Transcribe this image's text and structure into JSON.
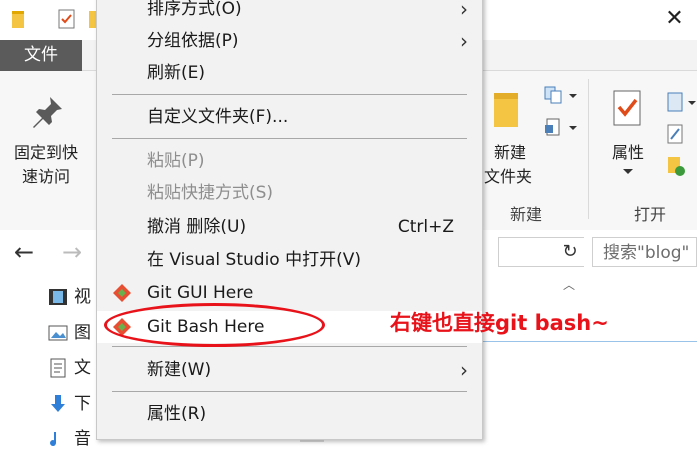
{
  "explorer": {
    "file_tab": "文件",
    "pin_label_line1": "固定到快",
    "pin_label_line2": "速访问",
    "new_folder_line1": "新建",
    "new_folder_line2": "文件夹",
    "new_group": "新建",
    "properties_label": "属性",
    "open_group": "打开",
    "search_placeholder": "搜索\"blog\"",
    "tree_items": [
      "视",
      "图",
      "文",
      "下",
      "音"
    ]
  },
  "context_menu": {
    "items": [
      {
        "label": "排序方式(O)",
        "shortcut": "",
        "submenu": true
      },
      {
        "label": "分组依据(P)",
        "shortcut": "",
        "submenu": true
      },
      {
        "label": "刷新(E)",
        "shortcut": "",
        "submenu": false
      },
      {
        "label": "自定义文件夹(F)...",
        "shortcut": "",
        "submenu": false
      },
      {
        "label": "粘贴(P)",
        "shortcut": "",
        "submenu": false,
        "disabled": true
      },
      {
        "label": "粘贴快捷方式(S)",
        "shortcut": "",
        "submenu": false,
        "disabled": true
      },
      {
        "label": "撤消 删除(U)",
        "shortcut": "Ctrl+Z",
        "submenu": false
      },
      {
        "label": "在 Visual Studio 中打开(V)",
        "shortcut": "",
        "submenu": false
      },
      {
        "label": "Git GUI Here",
        "shortcut": "",
        "submenu": false,
        "icon": "git-icon"
      },
      {
        "label": "Git Bash Here",
        "shortcut": "",
        "submenu": false,
        "icon": "git-icon",
        "highlighted": true
      },
      {
        "label": "新建(W)",
        "shortcut": "",
        "submenu": true
      },
      {
        "label": "属性(R)",
        "shortcut": "",
        "submenu": false
      }
    ]
  },
  "annotation": {
    "text": "右键也直接git bash~",
    "color": "#e8131a"
  }
}
